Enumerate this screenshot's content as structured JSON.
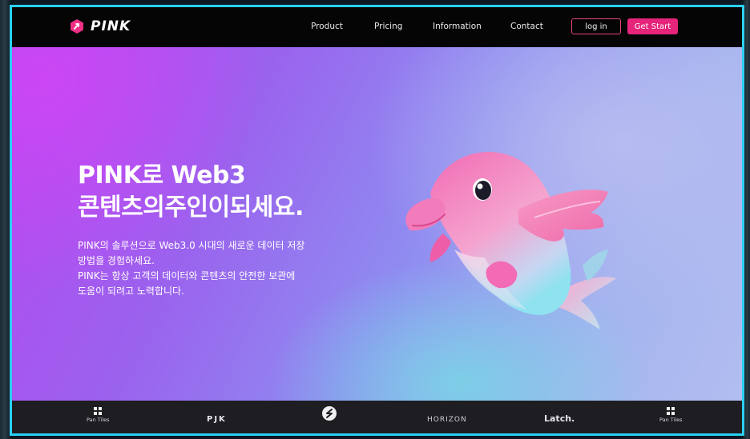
{
  "brand": {
    "name": "PINK",
    "accent": "#e6247a"
  },
  "nav": {
    "links": [
      "Product",
      "Pricing",
      "Information",
      "Contact"
    ],
    "login_label": "log in",
    "start_label": "Get Start"
  },
  "hero": {
    "title_line1": "PINK로 Web3",
    "title_line2": "콘텐츠의주인이되세요.",
    "desc_line1": "PINK의 솔루션으로 Web3.0 시대의 새로운 데이터 저장",
    "desc_line2": "방법을 경험하세요.",
    "desc_line3": "PINK는 항상 고객의 데이터와 콘텐츠의 안전한 보관에",
    "desc_line4": "도움이 되려고 노력합니다.",
    "image_icon": "pink-dolphin-illustration"
  },
  "partners": [
    {
      "name": "Pan Tiles",
      "icon": "grid-icon"
    },
    {
      "name": "PJK"
    },
    {
      "name": "",
      "icon": "circle-s-icon"
    },
    {
      "name": "HORIZON"
    },
    {
      "name": "Latch."
    },
    {
      "name": "Pan Tiles",
      "icon": "grid-icon"
    }
  ]
}
